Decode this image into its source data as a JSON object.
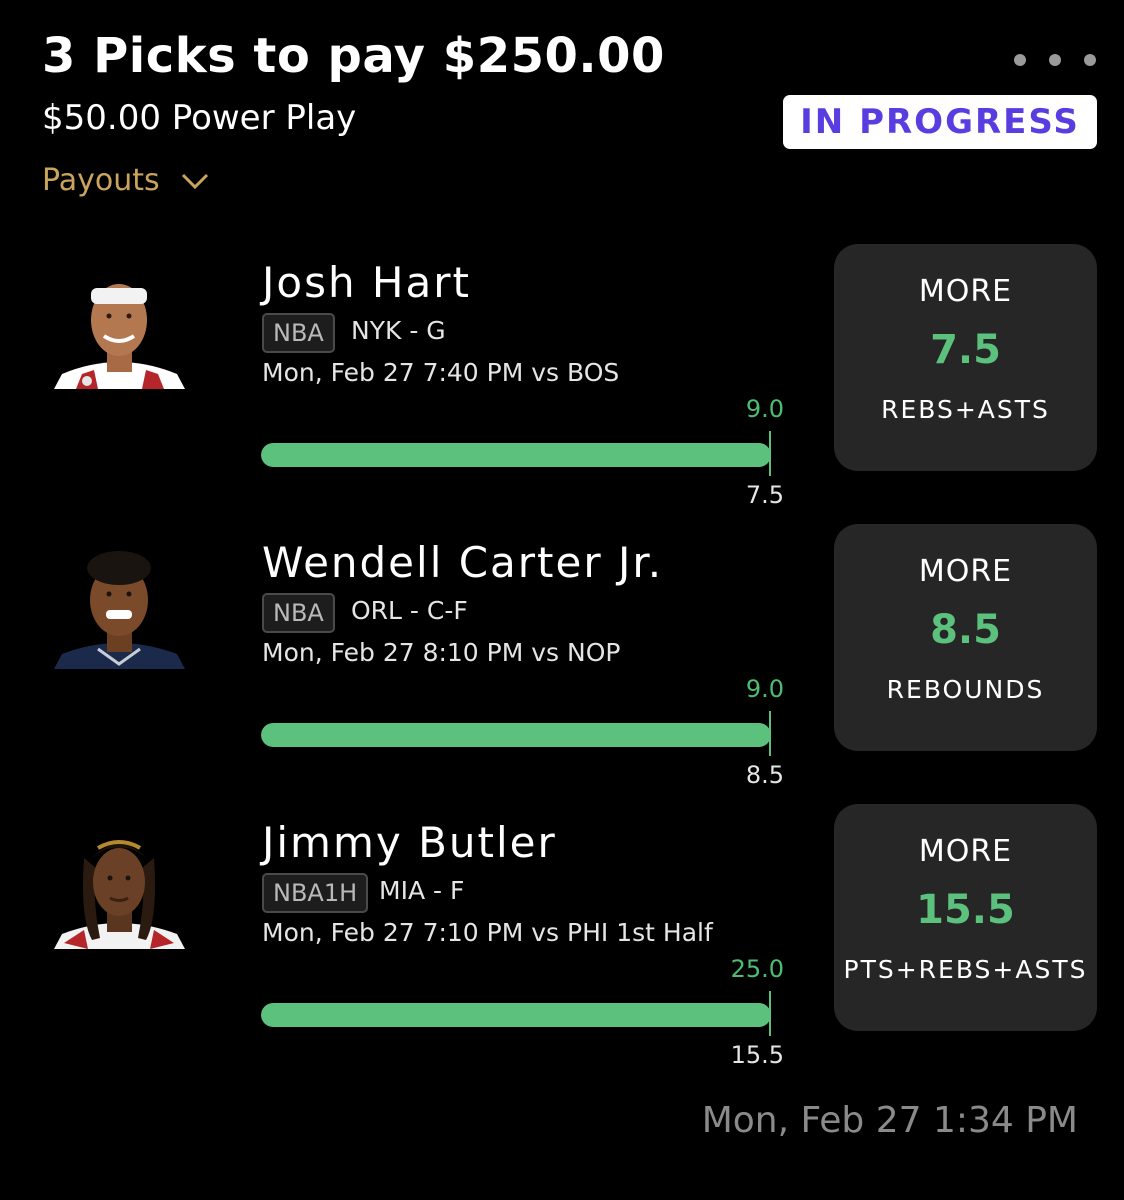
{
  "header": {
    "title": "3 Picks to pay $250.00",
    "subtitle": "$50.00 Power Play",
    "status": "IN PROGRESS",
    "payouts_label": "Payouts"
  },
  "picks": [
    {
      "player": "Josh Hart",
      "league": "NBA",
      "team_pos": "NYK - G",
      "game": "Mon, Feb 27 7:40 PM  vs BOS",
      "actual": "9.0",
      "line": "7.5",
      "direction": "MORE",
      "stat": "REBS+ASTS",
      "progress_percent": 100,
      "jersey_color": "#ffffff",
      "headband": true
    },
    {
      "player": "Wendell Carter Jr.",
      "league": "NBA",
      "team_pos": "ORL - C-F",
      "game": "Mon, Feb 27 8:10 PM  vs NOP",
      "actual": "9.0",
      "line": "8.5",
      "direction": "MORE",
      "stat": "REBOUNDS",
      "progress_percent": 100,
      "jersey_color": "#1b2a4a",
      "headband": false
    },
    {
      "player": "Jimmy Butler",
      "league": "NBA1H",
      "team_pos": "MIA - F",
      "game": "Mon, Feb 27 7:10 PM  vs PHI 1st Half",
      "actual": "25.0",
      "line": "15.5",
      "direction": "MORE",
      "stat": "PTS+REBS+ASTS",
      "progress_percent": 100,
      "jersey_color": "#ffffff",
      "headband": false
    }
  ],
  "footer": {
    "timestamp": "Mon, Feb 27 1:34 PM"
  },
  "colors": {
    "background": "#000000",
    "accent_green": "#5cc17d",
    "status_text": "#5a3de0",
    "payouts_gold": "#c9a45c",
    "card_bg": "#262626"
  }
}
